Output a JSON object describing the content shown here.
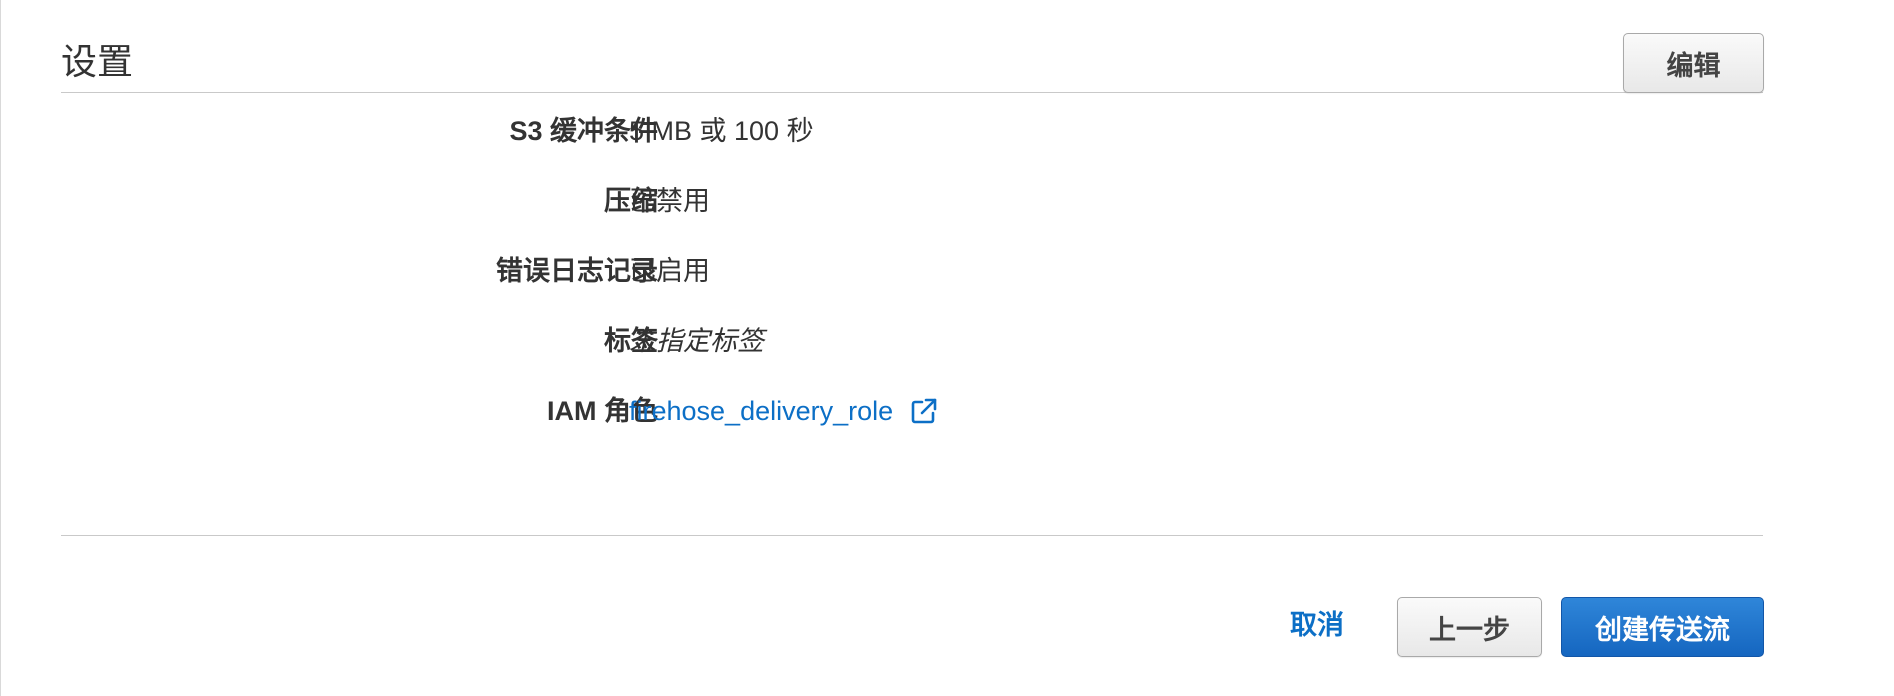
{
  "section": {
    "title": "设置",
    "edit_label": "编辑"
  },
  "settings": [
    {
      "label": "S3 缓冲条件",
      "value": "5 MB 或 100 秒"
    },
    {
      "label": "压缩",
      "value": "已禁用"
    },
    {
      "label": "错误日志记录",
      "value": "已启用"
    },
    {
      "label": "标签",
      "value": "未指定标签"
    },
    {
      "label": "IAM 角色",
      "value": "firehose_delivery_role",
      "icon": "external-link-icon"
    }
  ],
  "footer": {
    "cancel_label": "取消",
    "prev_label": "上一步",
    "create_label": "创建传送流"
  },
  "colors": {
    "link": "#0c6fc6",
    "primary_button": "#1a6fc9",
    "text": "#333333",
    "divider": "#c9c9c9"
  }
}
